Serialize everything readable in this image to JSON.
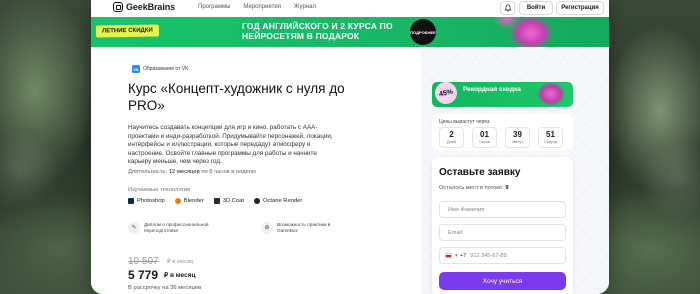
{
  "header": {
    "brand": "GeekBrains",
    "nav": [
      "Программы",
      "Мероприятия",
      "Журнал"
    ],
    "login_label": "Войти",
    "register_label": "Регистрация"
  },
  "banner": {
    "chip": "ЛЕТНИЕ СКИДКИ",
    "text": "ГОД АНГЛИЙСКОГО И 2 КУРСА ПО НЕЙРОСЕТЯМ В ПОДАРОК",
    "disc": "ПОДРОБНЕЕ"
  },
  "course": {
    "badge": "Образование от VK",
    "title": "Курс «Концепт-художник с нуля до PRO»",
    "description": "Научитесь создавать концепции для игр и кино, работать с ААА-проектами и инди-разработкой. Придумывайте персонажей, локации, интерфейсы и иллюстрации, которые передадут атмосферу и настроение. Освойте главные программы для работы и начните карьеру меньше, чем через год.",
    "duration_label": "Длительность:",
    "duration_value": "12 месяцев",
    "duration_rest": "по 8 часов в неделю",
    "tech_label": "Изучаемые технологии",
    "tech": [
      {
        "name": "Photoshop",
        "color": "#0f2a4a"
      },
      {
        "name": "Blender",
        "color": "#e87d0d"
      },
      {
        "name": "3D Coat",
        "color": "#2a2a2a"
      },
      {
        "name": "Octane Render",
        "color": "#222222"
      }
    ],
    "features": [
      {
        "icon": "diploma-icon",
        "text": "Диплом о профессиональной переподготовке"
      },
      {
        "icon": "gamepad-icon",
        "text": "Возможность практики в GameBox"
      }
    ],
    "price_old": "10 507",
    "price_old_unit": "₽ в месяц",
    "price": "5 779",
    "price_unit": "₽ в месяц",
    "installment": "В рассрочку на 36 месяцев"
  },
  "promo": {
    "percent": "45%",
    "text": "Рекордная скидка"
  },
  "timer": {
    "label": "Цены вырастут через:",
    "units": [
      {
        "value": "2",
        "unit": "Дней"
      },
      {
        "value": "01",
        "unit": "Часов"
      },
      {
        "value": "39",
        "unit": "Минут"
      },
      {
        "value": "51",
        "unit": "Секунд"
      }
    ]
  },
  "form": {
    "title": "Оставьте заявку",
    "seats_label": "Осталось мест в потоке:",
    "seats_value": "9",
    "name_placeholder": "Имя Фамилия",
    "email_placeholder": "Email",
    "phone_code": "+7",
    "phone_placeholder": "912 345-67-89",
    "submit_label": "Хочу учиться"
  },
  "colors": {
    "banner_green": "#17c36a",
    "submit_purple": "#7c3aed",
    "chip_yellow": "#e7f24a",
    "vk_blue": "#2787f5"
  }
}
